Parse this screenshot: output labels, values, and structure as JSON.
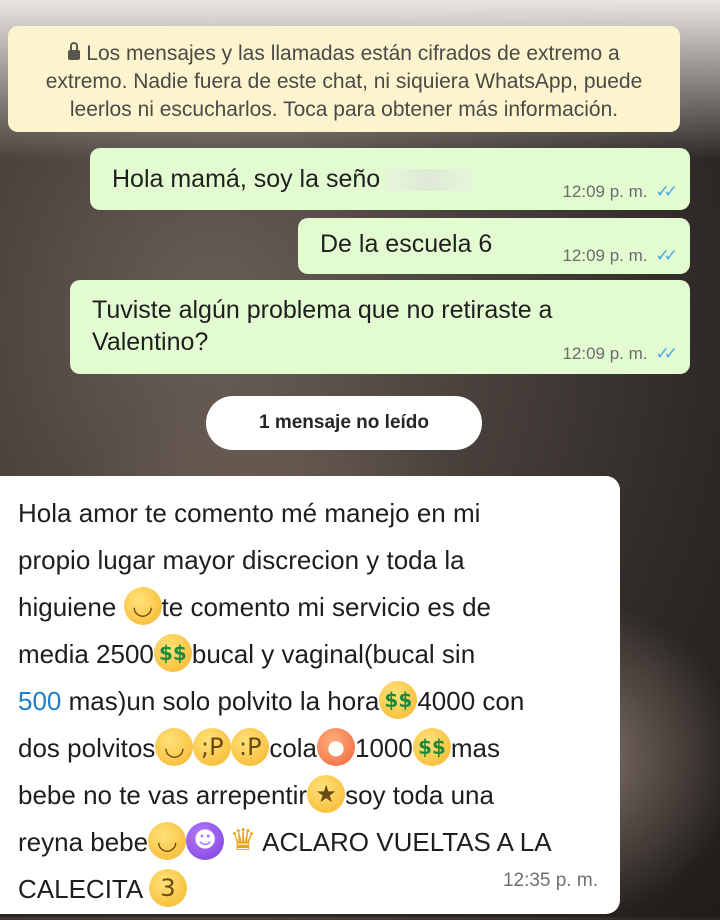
{
  "encryption_notice": {
    "line1": "Los mensajes y las llamadas están cifrados de extremo a",
    "line2": "extremo. Nadie fuera de este chat, ni siquiera WhatsApp, puede",
    "line3": "leerlos ni escucharlos. Toca para obtener más información.",
    "icon": "lock-icon"
  },
  "messages_out": [
    {
      "text": "Hola mamá, soy la seño",
      "time": "12:09 p. m."
    },
    {
      "text": "De la escuela 6",
      "time": "12:09 p. m."
    },
    {
      "text_line1": "Tuviste algún problema que no retiraste a",
      "text_line2": "Valentino?",
      "time": "12:09 p. m."
    }
  ],
  "unread_divider": "1 mensaje no leído",
  "incoming": {
    "time": "12:35 p. m.",
    "lines": {
      "l1": "Hola amor te comento mé manejo en mi",
      "l2": "propio lugar mayor discrecion y toda la",
      "l3a": "higuiene ",
      "l3b": "te comento mi servicio es de",
      "l4a": "media 2500",
      "l4b": "bucal y vaginal(bucal sin",
      "l5a": "500",
      "l5b": " mas)un solo polvito la hora",
      "l5c": "4000 con",
      "l6a": "dos polvitos",
      "l6b": "cola",
      "l6c": "1000",
      "l6d": "mas",
      "l7a": "bebe no te vas arrepentir",
      "l7b": "soy toda una",
      "l8a": "reyna bebe",
      "l8b": "ACLARO VUELTAS A LA",
      "l9a": "CALECITA "
    }
  },
  "colors": {
    "outgoing_bubble": "#e3fbd0",
    "incoming_bubble": "#ffffff",
    "banner": "#fcf3cf",
    "read_ticks": "#4aa7e8",
    "link_number": "#1e7ec8"
  }
}
